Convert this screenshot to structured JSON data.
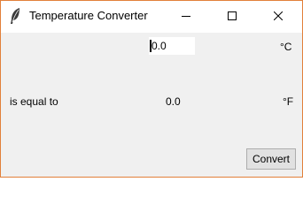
{
  "window": {
    "title": "Temperature Converter",
    "icon": "feather-icon",
    "controls": [
      "minimize-icon",
      "maximize-icon",
      "close-icon"
    ]
  },
  "input": {
    "value": "0.0",
    "unit": "°C"
  },
  "output": {
    "label": "is equal to",
    "value": "0.0",
    "unit": "°F"
  },
  "actions": {
    "convert_label": "Convert"
  },
  "colors": {
    "window_border": "#e2803a",
    "titlebar_bg": "#ffffff",
    "client_bg": "#f0f0f0",
    "button_bg": "#e1e1e1",
    "button_border": "#adadad"
  }
}
